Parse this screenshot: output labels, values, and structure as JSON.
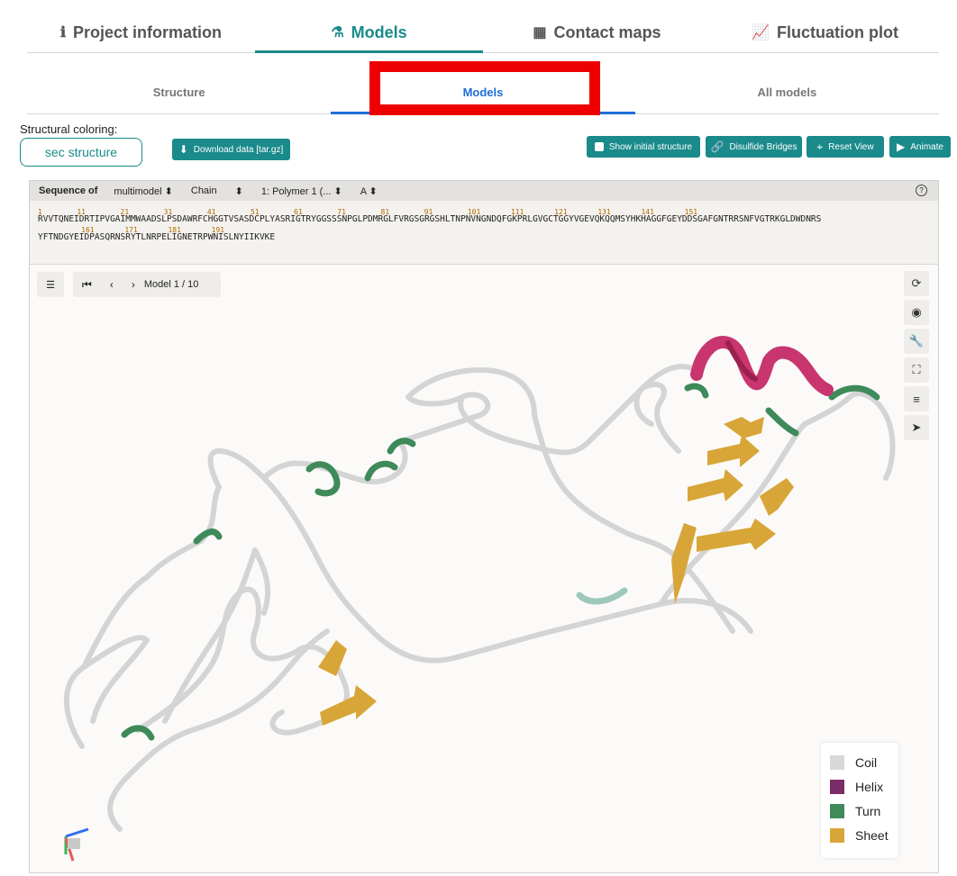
{
  "main_tabs": [
    {
      "label": "Project information",
      "icon": "info-icon"
    },
    {
      "label": "Models",
      "icon": "flask-icon"
    },
    {
      "label": "Contact maps",
      "icon": "grid-icon"
    },
    {
      "label": "Fluctuation plot",
      "icon": "chart-icon"
    }
  ],
  "sub_tabs": [
    {
      "label": "Structure"
    },
    {
      "label": "Models"
    },
    {
      "label": "All models"
    }
  ],
  "structural_coloring": {
    "label": "Structural coloring:",
    "value": "sec structure"
  },
  "buttons": {
    "download": "Download data [tar.gz]",
    "show_initial": "Show initial structure",
    "disulfide": "Disulfide Bridges",
    "reset": "Reset View",
    "animate": "Animate"
  },
  "sequence": {
    "label": "Sequence of",
    "model_select": "multimodel",
    "chain_label": "Chain",
    "polymer_select": "1: Polymer 1 (...",
    "chain_select": "A",
    "ruler1": "1        11        21        31        41        51        61        71        81        91        101       111       121       131       141       151",
    "line1": "RVVTQNEIDRTIPVGAIMMWAADSLPSDAWRFCHGGTVSASDCPLYASRIGTRYGGSSSNPGLPDMRGLFVRGSGRGSHLTNPNVNGNDQFGKPRLGVGCTGGYVGEVQKQQMSYHKHAGGFGEYDDSGAFGNTRRSNFVGTRKGLDWDNRS",
    "ruler2": "          161       171       181       191",
    "line2": "YFTNDGYEIDPASQRNSRYTLNRPELIGNETRPWNISLNYIIKVKE"
  },
  "model_nav": {
    "label": "Model 1 / 10"
  },
  "legend": [
    {
      "label": "Coil",
      "color": "#d8d8d8"
    },
    {
      "label": "Helix",
      "color": "#7b2b66"
    },
    {
      "label": "Turn",
      "color": "#3e8a5a"
    },
    {
      "label": "Sheet",
      "color": "#d8a638"
    }
  ]
}
